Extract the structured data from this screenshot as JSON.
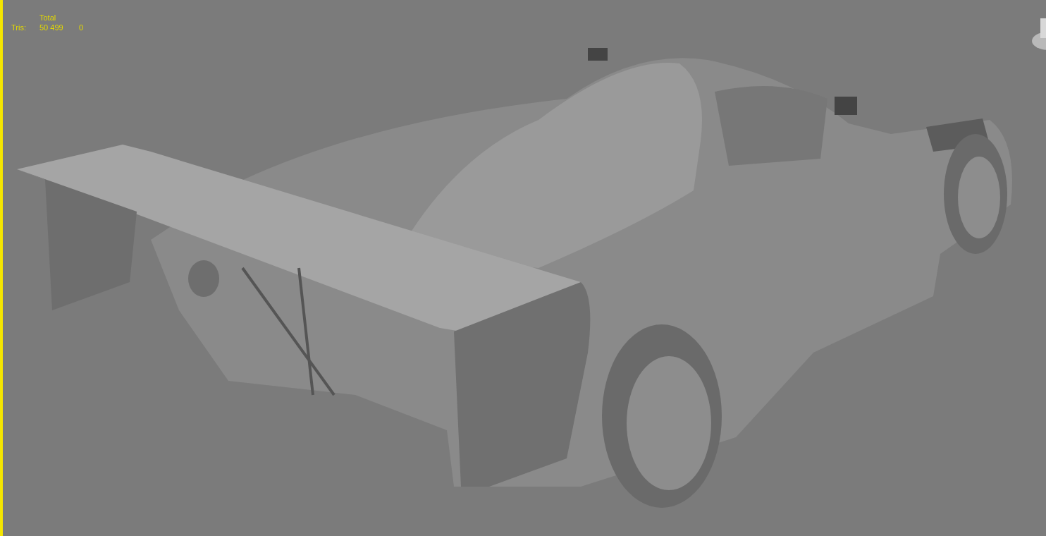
{
  "viewport": {
    "stats": {
      "header": "Total",
      "rows": [
        {
          "label": "Tris:",
          "total": "50 499",
          "column_3": "0"
        }
      ]
    }
  }
}
